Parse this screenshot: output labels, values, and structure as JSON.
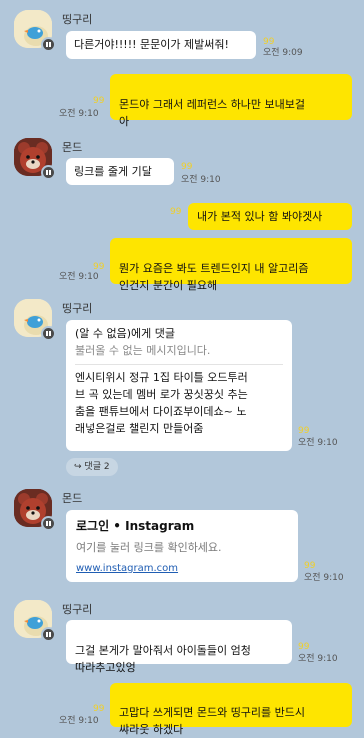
{
  "users": {
    "ttingguri": {
      "name": "띵구리"
    },
    "mondo": {
      "name": "몬드"
    }
  },
  "messages": [
    {
      "text": "다른거야!!!!! 문문이가 제발써줘!",
      "time": "오전 9:09",
      "unread": "99"
    },
    {
      "text": "몬드야 그래서 레퍼런스 하나만 보내보걸\n아",
      "time": "오전 9:10",
      "unread": "99"
    },
    {
      "text": "링크를 줄게 기달",
      "time": "오전 9:10",
      "unread": "99"
    },
    {
      "text": "내가 본적 있나 함 봐야겟사",
      "unread": "99"
    },
    {
      "text": "뭔가 요즘은 봐도 트렌드인지 내 알고리즘\n인건지 분간이 필요해",
      "time": "오전 9:10",
      "unread": "99"
    },
    {
      "quote_sender": "(알 수 없음)에게 댓글",
      "quote_text": "불러올 수 없는 메시지입니다.",
      "text": "엔시티위시 정규 1집 타이틀 오드투러\n브 곡 있는데 멤버 로가 꿍싯꿍싯 추는\n춤을 팬튜브에서 다이죠부이데쇼~ 노\n래넣은걸로 챌린지 만들어줌",
      "time": "오전 9:10",
      "unread": "99",
      "reply_label": "댓글 2"
    },
    {
      "link_title": "로그인 • Instagram",
      "link_desc": "여기를 눌러 링크를 확인하세요.",
      "link_url": "www.instagram.com",
      "time": "오전 9:10",
      "unread": "99"
    },
    {
      "text": "그걸 본게가 말아줘서 아이돌들이 엄청\n따라추고있엉",
      "time": "오전 9:10",
      "unread": "99"
    },
    {
      "text": "고맙다 쓰게되면 몬드와 띵구리를 반드시\n쌰라웃 하겠다",
      "time": "오전 9:10",
      "unread": "99"
    }
  ]
}
